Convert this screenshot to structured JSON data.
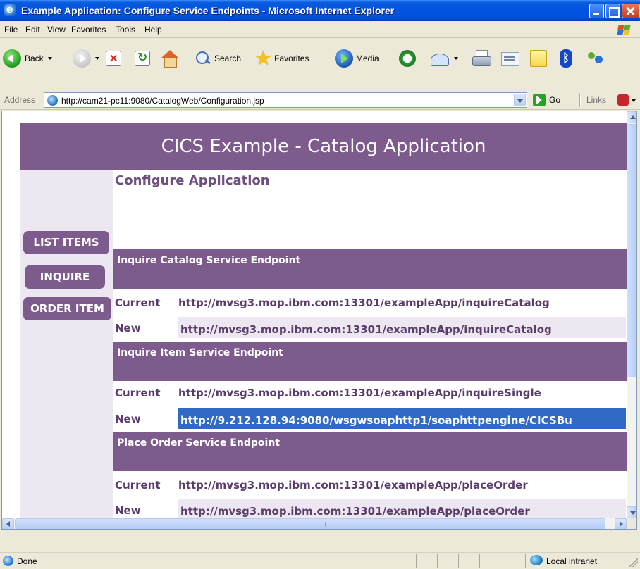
{
  "window": {
    "title": "Example Application: Configure Service Endpoints - Microsoft Internet Explorer"
  },
  "menu": [
    "File",
    "Edit",
    "View",
    "Favorites",
    "Tools",
    "Help"
  ],
  "toolbar": {
    "back_label": "Back",
    "search_label": "Search",
    "favorites_label": "Favorites",
    "media_label": "Media"
  },
  "address": {
    "label": "Address",
    "url": "http://cam21-pc11:9080/CatalogWeb/Configuration.jsp",
    "go_label": "Go",
    "links_label": "Links"
  },
  "page": {
    "banner": "CICS Example - Catalog Application",
    "heading": "Configure Application",
    "nav": [
      "LIST ITEMS",
      "INQUIRE",
      "ORDER ITEM"
    ],
    "sections": [
      {
        "title": "Inquire Catalog Service Endpoint",
        "current_label": "Current",
        "current_value": "http://mvsg3.mop.ibm.com:13301/exampleApp/inquireCatalog",
        "new_label": "New",
        "new_value": "http://mvsg3.mop.ibm.com:13301/exampleApp/inquireCatalog"
      },
      {
        "title": "Inquire Item Service Endpoint",
        "current_label": "Current",
        "current_value": "http://mvsg3.mop.ibm.com:13301/exampleApp/inquireSingle",
        "new_label": "New",
        "new_value": "http://9.212.128.94:9080/wsgwsoaphttp1/soaphttpengine/CICSBu"
      },
      {
        "title": "Place Order Service Endpoint",
        "current_label": "Current",
        "current_value": "http://mvsg3.mop.ibm.com:13301/exampleApp/placeOrder",
        "new_label": "New",
        "new_value": "http://mvsg3.mop.ibm.com:13301/exampleApp/placeOrder"
      }
    ]
  },
  "status": {
    "text": "Done",
    "zone": "Local intranet"
  },
  "colors": {
    "accent_purple": "#7d5b8d",
    "field_bg": "#ece7f0",
    "selection": "#316ac5"
  }
}
